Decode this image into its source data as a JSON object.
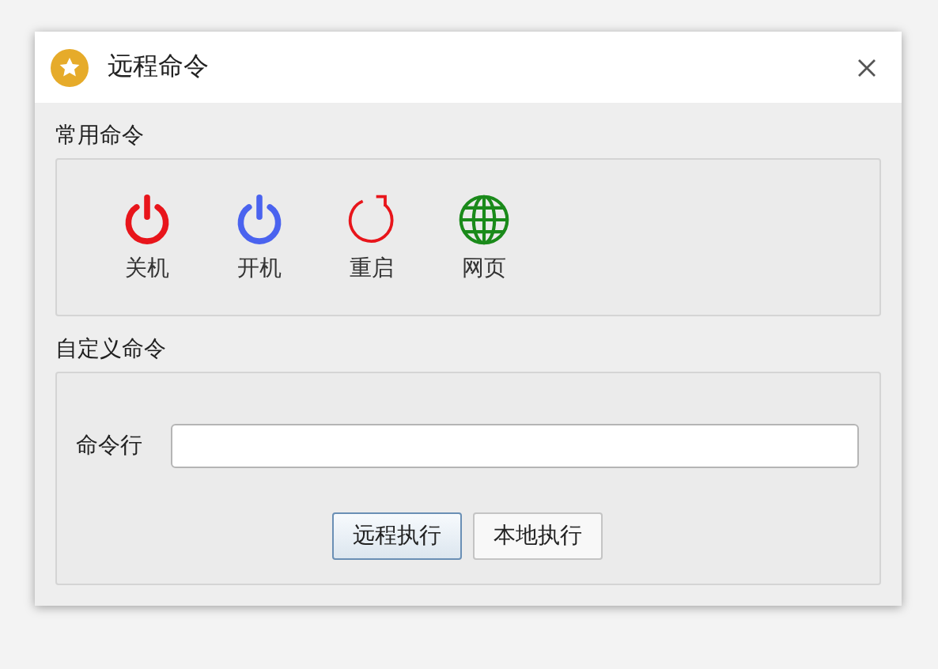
{
  "window": {
    "title": "远程命令"
  },
  "common": {
    "label": "常用命令",
    "commands": [
      {
        "kind": "shutdown",
        "label": "关机"
      },
      {
        "kind": "poweron",
        "label": "开机"
      },
      {
        "kind": "restart",
        "label": "重启"
      },
      {
        "kind": "web",
        "label": "网页"
      }
    ]
  },
  "custom": {
    "label": "自定义命令",
    "field_label": "命令行",
    "buttons": [
      {
        "label": "远程执行",
        "default": true
      },
      {
        "label": "本地执行",
        "default": false
      }
    ]
  }
}
